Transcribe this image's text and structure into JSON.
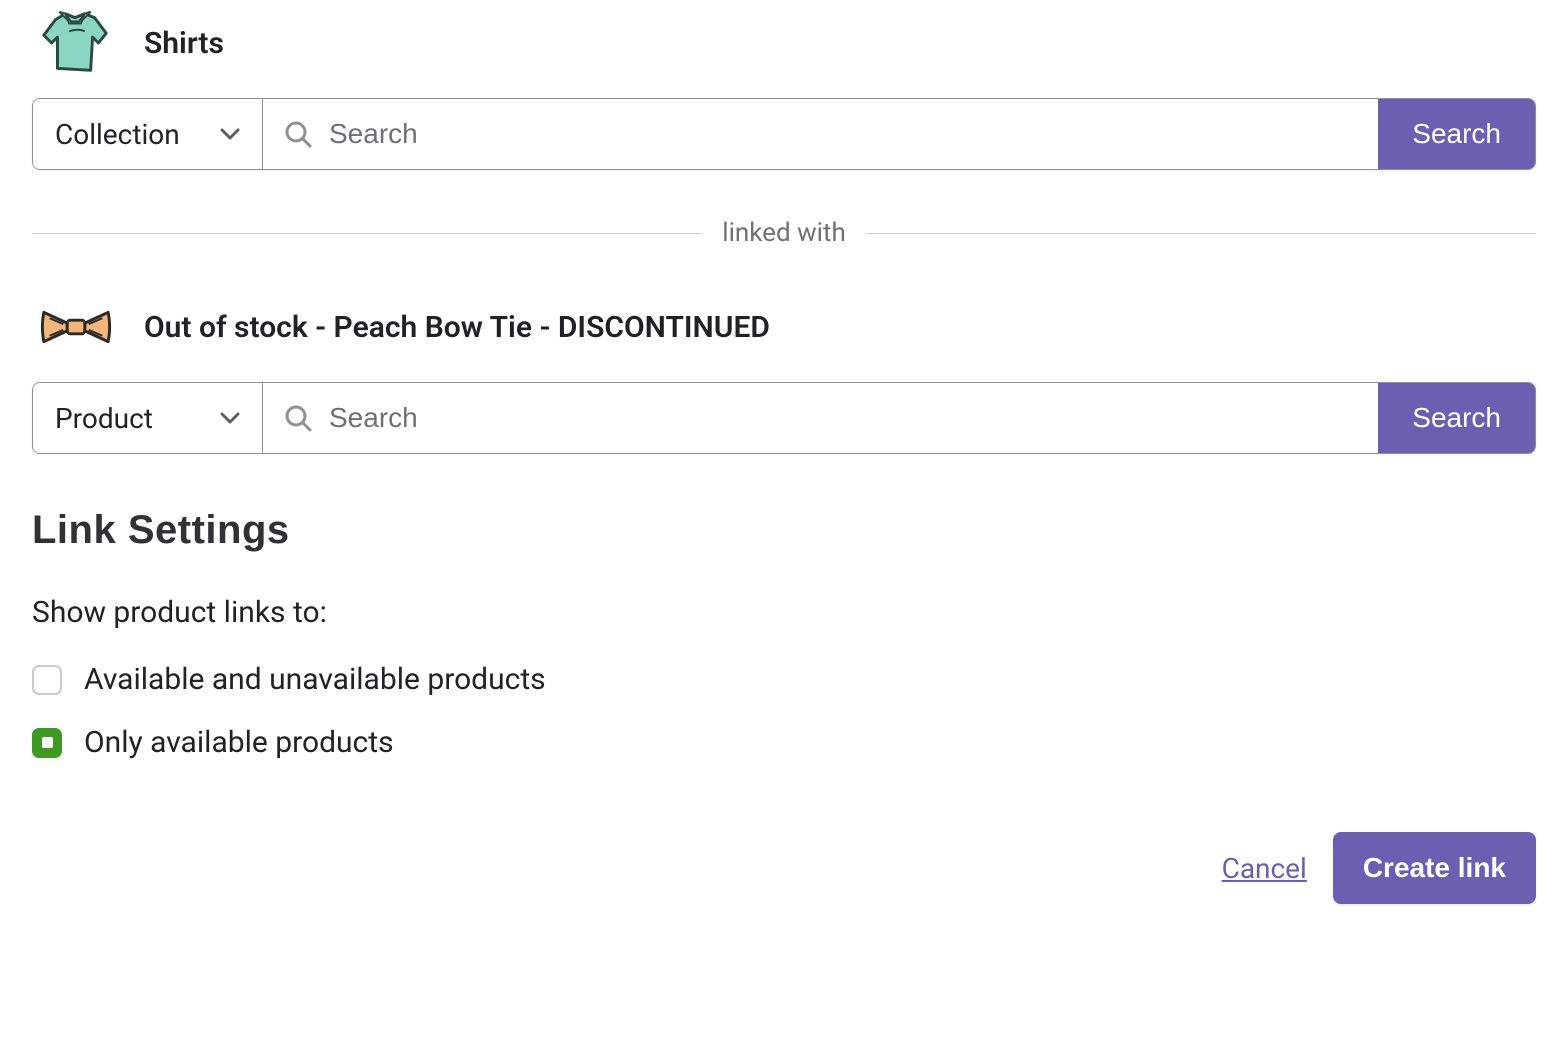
{
  "source": {
    "title": "Shirts",
    "dropdown_label": "Collection",
    "search_placeholder": "Search",
    "search_button": "Search"
  },
  "divider_text": "linked with",
  "target": {
    "title": "Out of stock - Peach Bow Tie - DISCONTINUED",
    "dropdown_label": "Product",
    "search_placeholder": "Search",
    "search_button": "Search"
  },
  "link_settings": {
    "heading": "Link Settings",
    "show_label": "Show product links to:",
    "options": [
      {
        "label": "Available and unavailable products",
        "checked": false
      },
      {
        "label": "Only available products",
        "checked": true
      }
    ]
  },
  "footer": {
    "cancel": "Cancel",
    "create": "Create link"
  }
}
